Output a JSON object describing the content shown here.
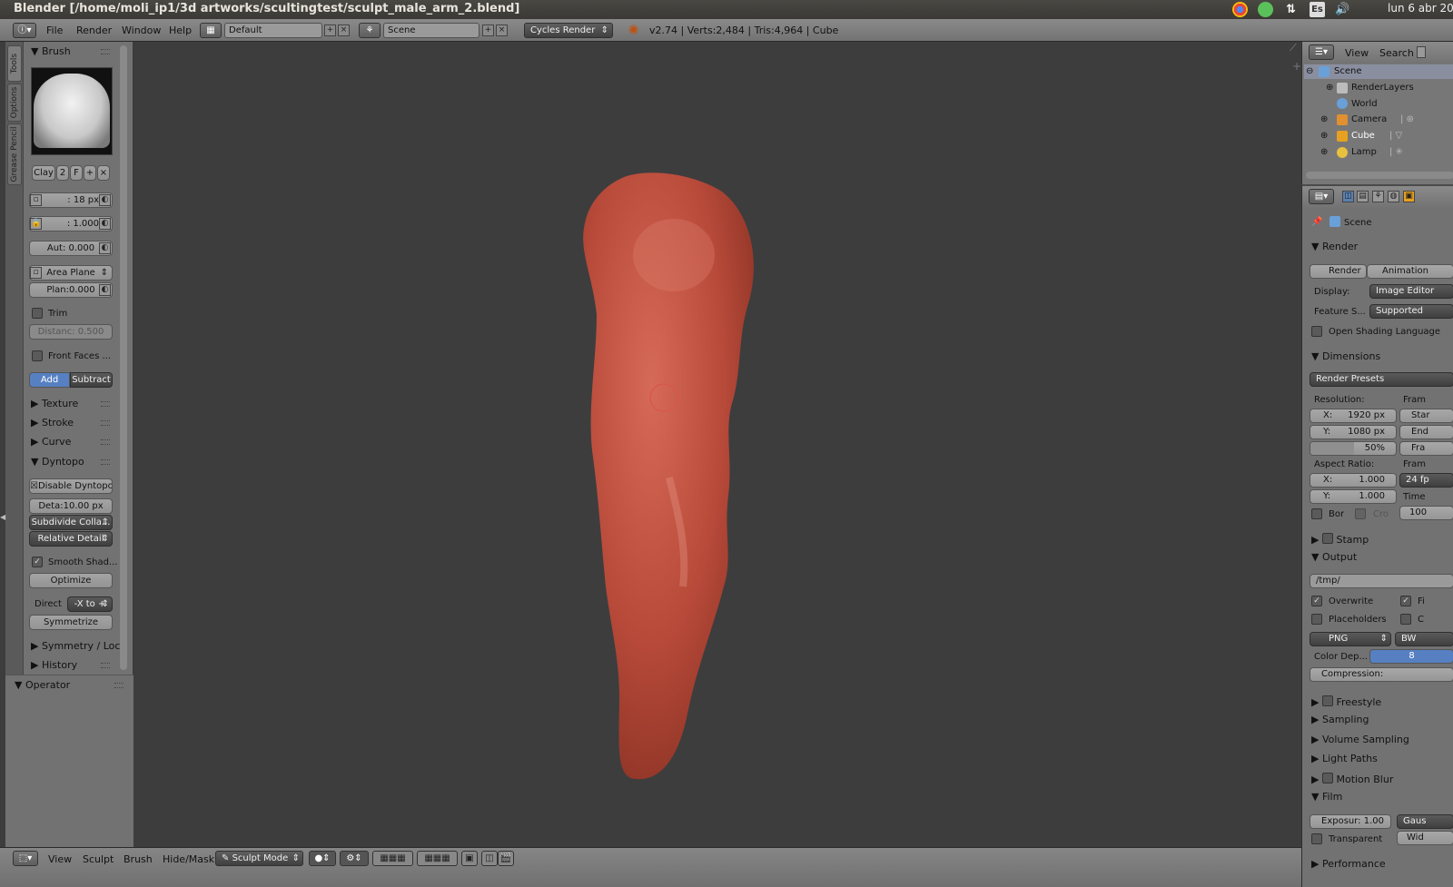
{
  "os": {
    "window_title": "Blender [/home/moli_ip1/3d artworks/scultingtest/sculpt_male_arm_2.blend]",
    "keyboard_layout": "Es",
    "clock": "lun 6 abr 20"
  },
  "header": {
    "menus": [
      "File",
      "Render",
      "Window",
      "Help"
    ],
    "layout": "Default",
    "scene": "Scene",
    "engine": "Cycles Render",
    "stats": "v2.74 | Verts:2,484 | Tris:4,964 | Cube"
  },
  "tabs": [
    "Tools",
    "Options",
    "Grease Pencil"
  ],
  "brush_panel": {
    "title": "Brush",
    "brush_name": "Clay",
    "brush_users": "2",
    "brush_fake": "F",
    "radius": ": 18 px",
    "strength": ": 1.000",
    "autosmooth": "Aut:  0.000",
    "sculpt_plane": "Area Plane",
    "plane_offset": "Plan:0.000",
    "trim_label": "Trim",
    "distance": "Distanc: 0.500",
    "front_faces": "Front Faces ...",
    "add": "Add",
    "subtract": "Subtract"
  },
  "sections": {
    "texture": "Texture",
    "stroke": "Stroke",
    "curve": "Curve",
    "dyntopo": "Dyntopo",
    "symmetry": "Symmetry / Lock",
    "history": "History",
    "operator": "Operator"
  },
  "dyntopo": {
    "disable": "Disable Dyntopo",
    "detail": "Deta:10.00 px",
    "subdivide": "Subdivide Colla...",
    "relative": "Relative Detail",
    "smooth": "Smooth Shad...",
    "optimize": "Optimize",
    "direction_label": "Direct",
    "direction": "-X to +",
    "symmetrize": "Symmetrize"
  },
  "bottom": {
    "menus": [
      "View",
      "Sculpt",
      "Brush",
      "Hide/Mask"
    ],
    "mode": "Sculpt Mode"
  },
  "outliner": {
    "view": "View",
    "search": "Search",
    "items": [
      {
        "label": "Scene",
        "color": "#6aa0d8"
      },
      {
        "label": "RenderLayers",
        "color": "#bcbcbc"
      },
      {
        "label": "World",
        "color": "#6aa0d8"
      },
      {
        "label": "Camera",
        "color": "#e09030"
      },
      {
        "label": "Cube",
        "color": "#e8a020"
      },
      {
        "label": "Lamp",
        "color": "#e8c040"
      }
    ]
  },
  "properties": {
    "context": "Scene",
    "render_section": "Render",
    "render_btn": "Render",
    "animation_btn": "Animation",
    "display_label": "Display:",
    "display_value": "Image Editor",
    "feature_label": "Feature S...",
    "feature_value": "Supported",
    "osl": "Open Shading Language",
    "dimensions": "Dimensions",
    "presets": "Render Presets",
    "resolution": "Resolution:",
    "frame_label": "Fram",
    "res_x": "1920 px",
    "res_y": "1080 px",
    "res_pct": "50%",
    "x_label": "X:",
    "y_label": "Y:",
    "frame_start": "Star",
    "frame_end": "End",
    "frame_step": "Fra",
    "aspect": "Aspect Ratio:",
    "frame_rate_label": "Fram",
    "asp_x": "1.000",
    "asp_y": "1.000",
    "fps": "24 fp",
    "time_label": "Time",
    "time_val": "100",
    "border": "Bor",
    "crop": "Cro",
    "stamp": "Stamp",
    "output": "Output",
    "path": "/tmp/",
    "overwrite": "Overwrite",
    "file_ext": "Fi",
    "placeholders": "Placeholders",
    "cache": "C",
    "format": "PNG",
    "bw": "BW",
    "color_depth_label": "Color Dep...",
    "color_depth": "8",
    "compression": "Compression:",
    "freestyle": "Freestyle",
    "sampling": "Sampling",
    "volume": "Volume Sampling",
    "lightpaths": "Light Paths",
    "motionblur": "Motion Blur",
    "film": "Film",
    "exposure": "Exposur: 1.00",
    "filter": "Gaus",
    "transparent": "Transparent",
    "width": "Wid",
    "performance": "Performance"
  },
  "colors": {
    "mesh": "#b84a3a",
    "accent": "#5680c2",
    "background": "#3d3d3d"
  }
}
